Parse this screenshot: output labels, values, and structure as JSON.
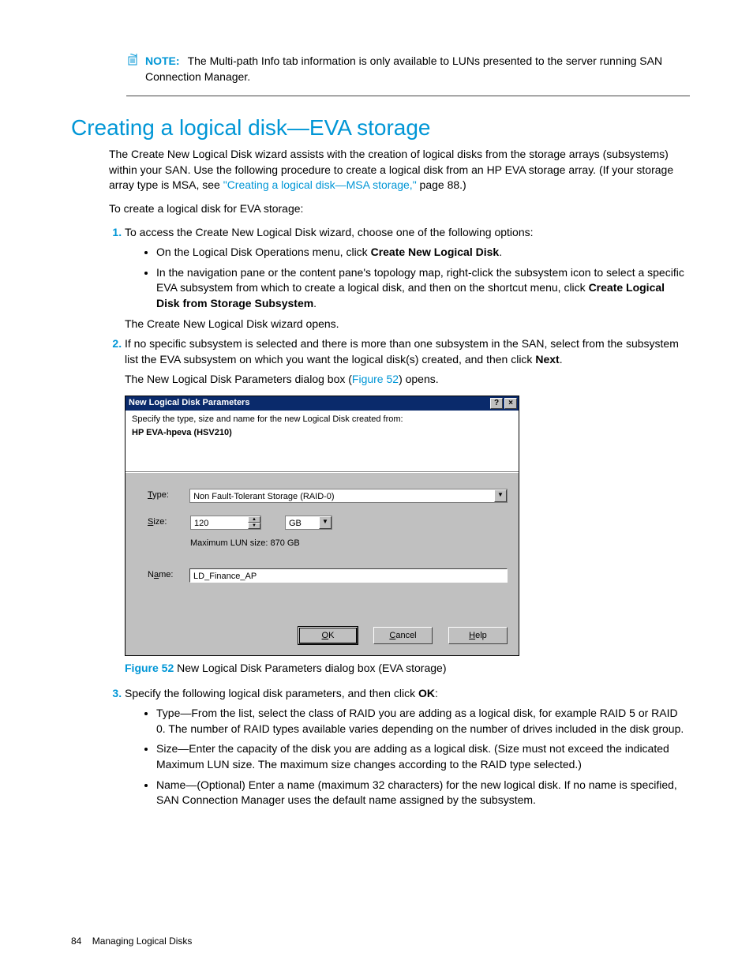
{
  "note": {
    "label": "NOTE:",
    "text": "The Multi-path Info tab information is only available to LUNs presented to the server running SAN Connection Manager."
  },
  "heading": "Creating a logical disk—EVA storage",
  "intro": {
    "p1a": "The Create New Logical Disk wizard assists with the creation of logical disks from the storage arrays (subsystems) within your SAN. Use the following procedure to create a logical disk from an HP EVA storage array. (If your storage array type is MSA, see ",
    "p1link": "\"Creating a logical disk—MSA storage,\"",
    "p1b": " page 88.)",
    "p2": "To create a logical disk for EVA storage:"
  },
  "steps": {
    "s1": "To access the Create New Logical Disk wizard, choose one of the following options:",
    "s1b1a": "On the Logical Disk Operations menu, click ",
    "s1b1bold": "Create New Logical Disk",
    "s1b1b": ".",
    "s1b2a": "In the navigation pane or the content pane's topology map, right-click the subsystem icon to select a specific EVA subsystem from which to create a logical disk, and then on the shortcut menu, click ",
    "s1b2bold": "Create Logical Disk from Storage Subsystem",
    "s1b2b": ".",
    "s1after": "The Create New Logical Disk wizard opens.",
    "s2a": "If no specific subsystem is selected and there is more than one subsystem in the SAN, select from the subsystem list the EVA subsystem on which you want the logical disk(s) created, and then click ",
    "s2bold": "Next",
    "s2b": ".",
    "s2after_a": "The New Logical Disk Parameters dialog box (",
    "s2after_link": "Figure 52",
    "s2after_b": ") opens.",
    "s3a": "Specify the following logical disk parameters, and then click ",
    "s3bold": "OK",
    "s3b": ":",
    "s3b1": "Type—From the list, select the class of RAID you are adding as a logical disk, for example RAID 5 or RAID 0. The number of RAID types available varies depending on the number of drives included in the disk group.",
    "s3b2": "Size—Enter the capacity of the disk you are adding as a logical disk. (Size must not exceed the indicated Maximum LUN size. The maximum size changes according to the RAID type selected.)",
    "s3b3": "Name—(Optional) Enter a name (maximum 32 characters) for the new logical disk. If no name is specified, SAN Connection Manager uses the default name assigned by the subsystem."
  },
  "dialog": {
    "title": "New Logical Disk Parameters",
    "instruction": "Specify the type, size and name for the new Logical Disk created from:",
    "device": "HP EVA-hpeva (HSV210)",
    "type_label": "Type:",
    "type_value": "Non Fault-Tolerant Storage (RAID-0)",
    "size_label": "Size:",
    "size_value": "120",
    "size_unit": "GB",
    "max_lun": "Maximum LUN size: 870 GB",
    "name_label": "Name:",
    "name_value": "LD_Finance_AP",
    "ok": "OK",
    "cancel": "Cancel",
    "help": "Help"
  },
  "figure": {
    "label": "Figure 52",
    "caption": " New Logical Disk Parameters dialog box (EVA storage)"
  },
  "footer": {
    "page": "84",
    "chapter": "Managing Logical Disks"
  }
}
